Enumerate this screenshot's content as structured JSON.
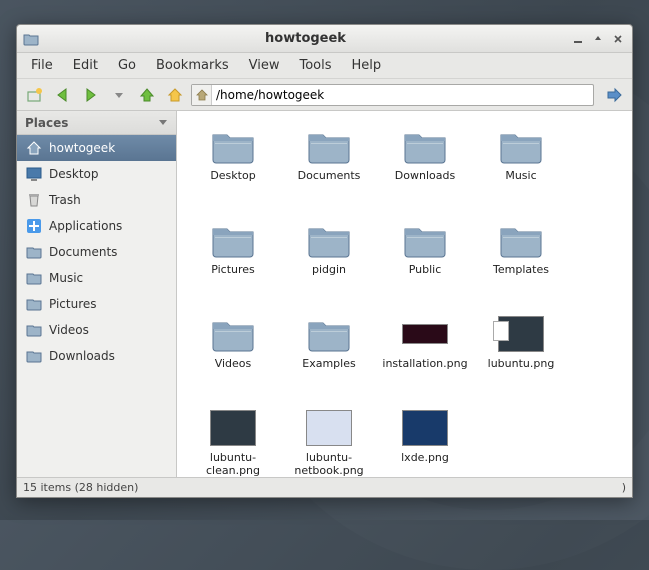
{
  "window": {
    "title": "howtogeek"
  },
  "menubar": [
    "File",
    "Edit",
    "Go",
    "Bookmarks",
    "View",
    "Tools",
    "Help"
  ],
  "path": "/home/howtogeek",
  "sidebar": {
    "header": "Places",
    "items": [
      {
        "label": "howtogeek",
        "icon": "home",
        "selected": true
      },
      {
        "label": "Desktop",
        "icon": "desktop",
        "selected": false
      },
      {
        "label": "Trash",
        "icon": "trash",
        "selected": false
      },
      {
        "label": "Applications",
        "icon": "apps",
        "selected": false
      },
      {
        "label": "Documents",
        "icon": "folder",
        "selected": false
      },
      {
        "label": "Music",
        "icon": "folder",
        "selected": false
      },
      {
        "label": "Pictures",
        "icon": "folder",
        "selected": false
      },
      {
        "label": "Videos",
        "icon": "folder",
        "selected": false
      },
      {
        "label": "Downloads",
        "icon": "folder",
        "selected": false
      }
    ]
  },
  "files": [
    {
      "label": "Desktop",
      "type": "folder"
    },
    {
      "label": "Documents",
      "type": "folder"
    },
    {
      "label": "Downloads",
      "type": "folder"
    },
    {
      "label": "Music",
      "type": "folder"
    },
    {
      "label": "Pictures",
      "type": "folder"
    },
    {
      "label": "pidgin",
      "type": "folder"
    },
    {
      "label": "Public",
      "type": "folder"
    },
    {
      "label": "Templates",
      "type": "folder"
    },
    {
      "label": "Videos",
      "type": "folder"
    },
    {
      "label": "Examples",
      "type": "folder"
    },
    {
      "label": "installation.png",
      "type": "thumb",
      "thumb": "install"
    },
    {
      "label": "lubuntu.png",
      "type": "thumb",
      "thumb": "lubuntu"
    },
    {
      "label": "lubuntu-clean.png",
      "type": "thumb",
      "thumb": "clean"
    },
    {
      "label": "lubuntu-netbook.png",
      "type": "thumb",
      "thumb": "netbook"
    },
    {
      "label": "lxde.png",
      "type": "thumb",
      "thumb": "lxde"
    }
  ],
  "status": {
    "left": "15 items (28 hidden)",
    "right": ")"
  }
}
